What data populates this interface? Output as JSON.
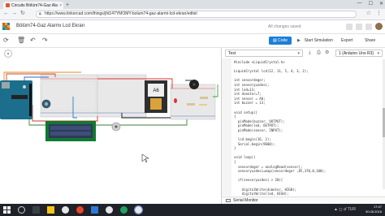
{
  "browser": {
    "tab_title": "Circuits Bölüm74-Gaz Ala",
    "tab_close": "×",
    "new_tab": "+",
    "window_controls": [
      "—",
      "☐",
      "✕"
    ],
    "url": "https://www.tinkercad.com/things/jfd147YMOMY-bolum74-gaz-alarmi-lcd-ekran/editel"
  },
  "header": {
    "design_title": "Bölüm74-Gaz Alarmı Lcd Ekran",
    "status": "All changes saved"
  },
  "toolbar": {
    "code_label": "Code",
    "simulate_label": "Start Simulation",
    "export_label": "Export",
    "share_label": "Share"
  },
  "code_panel": {
    "mode": "Text",
    "board": "1 (Arduino Uno R3)",
    "lines": [
      "#include <LiquidCrystal.h>",
      "",
      "LiquidCrystal lcd(12, 11, 5, 4, 3, 2);",
      "",
      "int sensordeger;",
      "int sensoryuzdesi;",
      "int led=13;",
      "int dcmotor=7;",
      "int sensor = A0;",
      "int buzzer = 13;",
      "",
      "void setup()",
      "{",
      "  pinMode(buzzer, OUTPUT);",
      "  pinMode(led, OUTPUT);",
      "  pinMode(sensor, INPUT);",
      "",
      "  lcd.begin(16, 2);",
      "  Serial.begin(9600);",
      "}",
      "",
      "void loop()",
      "{",
      "  sensordeger = analogRead(sensor);",
      "  sensoryuzdesi=map(sensordeger ,85,370,0,100);",
      "",
      "  if(sensoryuzdesi > 20){",
      "",
      "    digitalWrite(dcmotor, HIGH);",
      "    digitalWrite(led, HIGH);",
      "",
      "    tone(buzzer,450);"
    ],
    "serial_monitor": "Serial Monitor"
  },
  "taskbar": {
    "time": "17:47",
    "date": "30.08.2018",
    "tray": "▲ ◻ ⅆ TUR"
  },
  "colors": {
    "accent": "#1c7ed6",
    "breadboard": "#e6e6e6",
    "arduino": "#1b6e8c",
    "lcd": "#2d3a5c",
    "taskbar": "#1f2228"
  }
}
